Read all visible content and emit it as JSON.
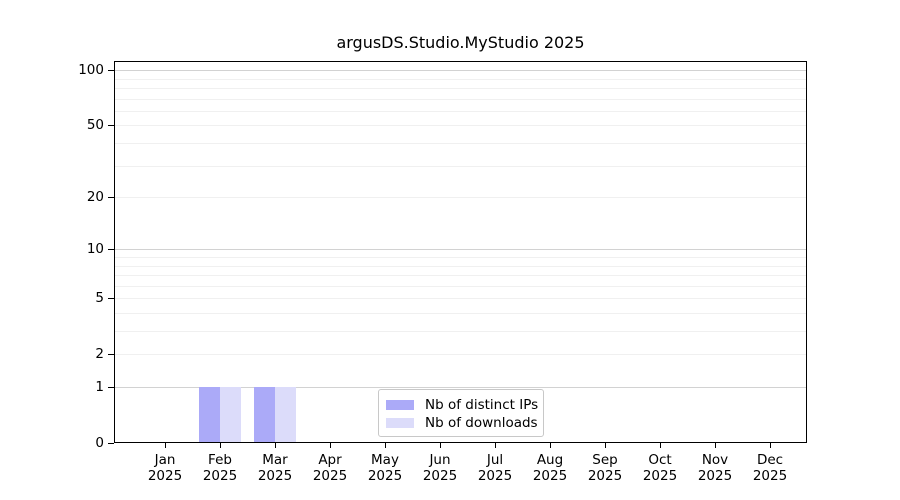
{
  "chart_data": {
    "type": "bar",
    "title": "argusDS.Studio.MyStudio 2025",
    "categories": [
      "Jan 2025",
      "Feb 2025",
      "Mar 2025",
      "Apr 2025",
      "May 2025",
      "Jun 2025",
      "Jul 2025",
      "Aug 2025",
      "Sep 2025",
      "Oct 2025",
      "Nov 2025",
      "Dec 2025"
    ],
    "series": [
      {
        "name": "Nb of distinct IPs",
        "color": "#abaaf8",
        "values": [
          0,
          1,
          1,
          0,
          0,
          0,
          0,
          0,
          0,
          0,
          0,
          0
        ]
      },
      {
        "name": "Nb of downloads",
        "color": "#dcdcfa",
        "values": [
          0,
          1,
          1,
          0,
          0,
          0,
          0,
          0,
          0,
          0,
          0,
          0
        ]
      }
    ],
    "yscale": "log1p",
    "ylim": [
      0,
      112
    ],
    "y_tick_values": [
      0,
      1,
      2,
      5,
      10,
      20,
      50,
      100
    ],
    "y_tick_labels": [
      "0",
      "1",
      "2",
      "5",
      "10",
      "20",
      "50",
      "100"
    ],
    "major_gridline_values": [
      1,
      10,
      100
    ],
    "minor_gridline_values": [
      2,
      3,
      4,
      5,
      6,
      7,
      8,
      9,
      20,
      30,
      40,
      50,
      60,
      70,
      80,
      90
    ],
    "grid": "on",
    "legend_position": "lower center",
    "colors": {
      "bar_distinct_ips": "#abaaf8",
      "bar_downloads": "#dcdcfa",
      "grid_major": "#d2d2d2",
      "grid_minor": "#f0f0f0",
      "spine": "#000000",
      "text": "#000000",
      "legend_border": "#c8c8c8"
    }
  }
}
